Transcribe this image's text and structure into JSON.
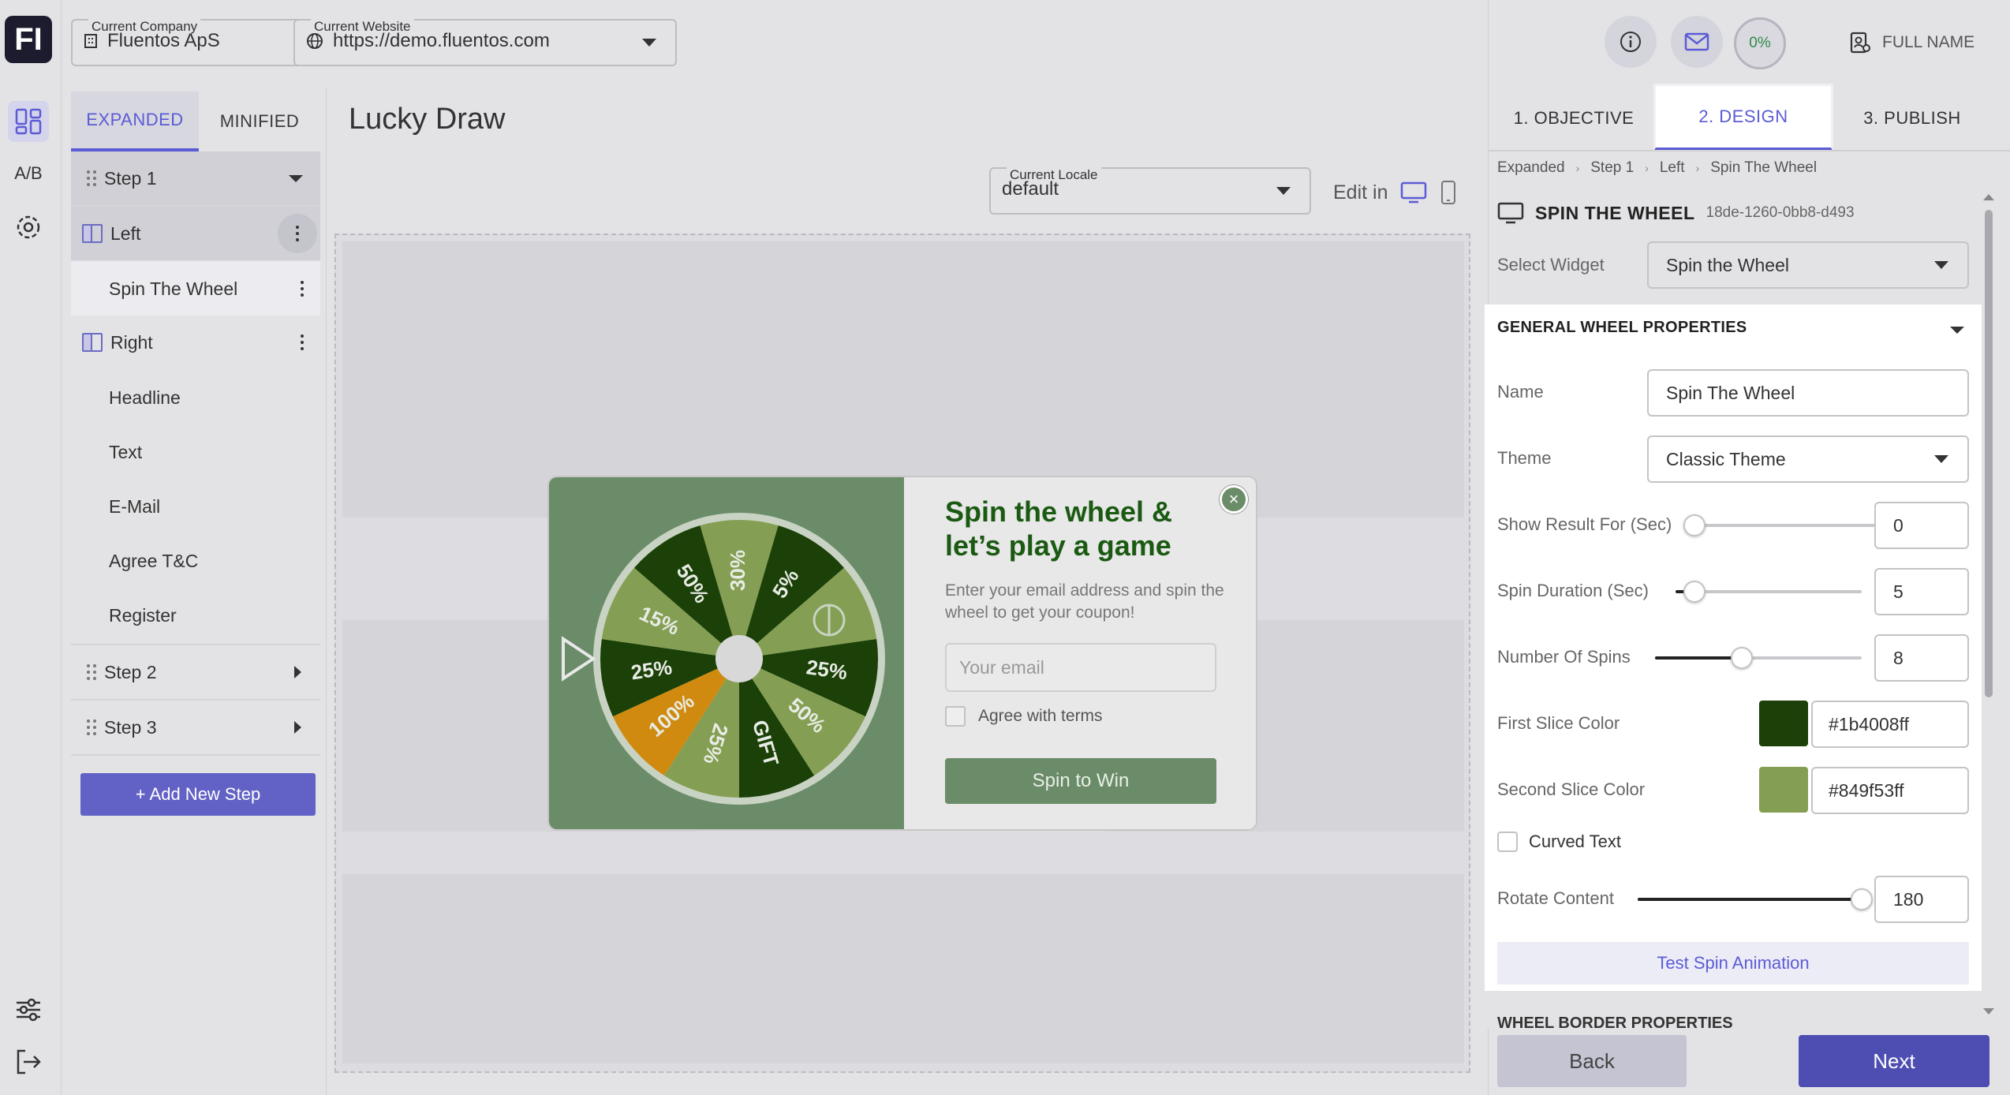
{
  "logo": {
    "text": "FI"
  },
  "rail": {
    "ab_label": "A/B"
  },
  "topbar": {
    "company": {
      "label": "Current Company",
      "value": "Fluentos ApS"
    },
    "website": {
      "label": "Current Website",
      "value": "https://demo.fluentos.com"
    }
  },
  "tree": {
    "tabs": [
      {
        "label": "EXPANDED",
        "active": true
      },
      {
        "label": "MINIFIED",
        "active": false
      }
    ],
    "step1": {
      "label": "Step 1"
    },
    "left": {
      "label": "Left"
    },
    "spin_the_wheel": {
      "label": "Spin The Wheel"
    },
    "right": {
      "label": "Right"
    },
    "right_children": [
      {
        "label": "Headline"
      },
      {
        "label": "Text"
      },
      {
        "label": "E-Mail"
      },
      {
        "label": "Agree T&C"
      },
      {
        "label": "Register"
      }
    ],
    "step2": {
      "label": "Step 2"
    },
    "step3": {
      "label": "Step 3"
    },
    "add_step": {
      "label": "+ Add New Step"
    }
  },
  "main": {
    "title": "Lucky Draw",
    "locale": {
      "label": "Current Locale",
      "value": "default"
    },
    "edit_in": "Edit in"
  },
  "popup": {
    "title": "Spin the wheel & let’s play a game",
    "description": "Enter your email address and spin the wheel to get your coupon!",
    "email_placeholder": "Your email",
    "agree_label": "Agree with terms",
    "cta_label": "Spin to Win",
    "close_label": "×",
    "wheel": {
      "segments": [
        "30%",
        "5%",
        "",
        "25%",
        "50%",
        "GIFT",
        "25%",
        "100%",
        "25%",
        "15%",
        "50%"
      ],
      "colors": {
        "first": "#1b4008",
        "second": "#849f53",
        "highlight": "#d08a10"
      }
    }
  },
  "panel": {
    "header": {
      "progress": "0%",
      "user": "FULL NAME"
    },
    "tabs": [
      {
        "label": "1. OBJECTIVE",
        "active": false
      },
      {
        "label": "2. DESIGN",
        "active": true
      },
      {
        "label": "3. PUBLISH",
        "active": false
      }
    ],
    "breadcrumb": [
      "Expanded",
      "Step 1",
      "Left",
      "Spin The Wheel"
    ],
    "widget": {
      "title": "SPIN THE WHEEL",
      "id": "18de-1260-0bb8-d493"
    },
    "select_widget": {
      "label": "Select Widget",
      "value": "Spin the Wheel"
    },
    "section_title": "GENERAL WHEEL PROPERTIES",
    "name": {
      "label": "Name",
      "value": "Spin The Wheel"
    },
    "theme": {
      "label": "Theme",
      "value": "Classic Theme"
    },
    "show_result": {
      "label": "Show Result For (Sec)",
      "value": "0",
      "fraction": 0.0
    },
    "spin_duration": {
      "label": "Spin Duration (Sec)",
      "value": "5",
      "fraction": 0.1
    },
    "num_spins": {
      "label": "Number Of Spins",
      "value": "8",
      "fraction": 0.42
    },
    "first_slice": {
      "label": "First Slice Color",
      "value": "#1b4008ff",
      "color": "#1b4008"
    },
    "second_slice": {
      "label": "Second Slice Color",
      "value": "#849f53ff",
      "color": "#849f53"
    },
    "curved_text": {
      "label": "Curved Text"
    },
    "rotate": {
      "label": "Rotate Content",
      "value": "180",
      "fraction": 1.0
    },
    "test_btn": "Test Spin Animation",
    "next_section": "WHEEL BORDER PROPERTIES",
    "back": "Back",
    "next": "Next"
  },
  "colors": {
    "accent": "#5b5bd6",
    "popup_green": "#6b8c69",
    "title_green": "#1b5a12"
  }
}
